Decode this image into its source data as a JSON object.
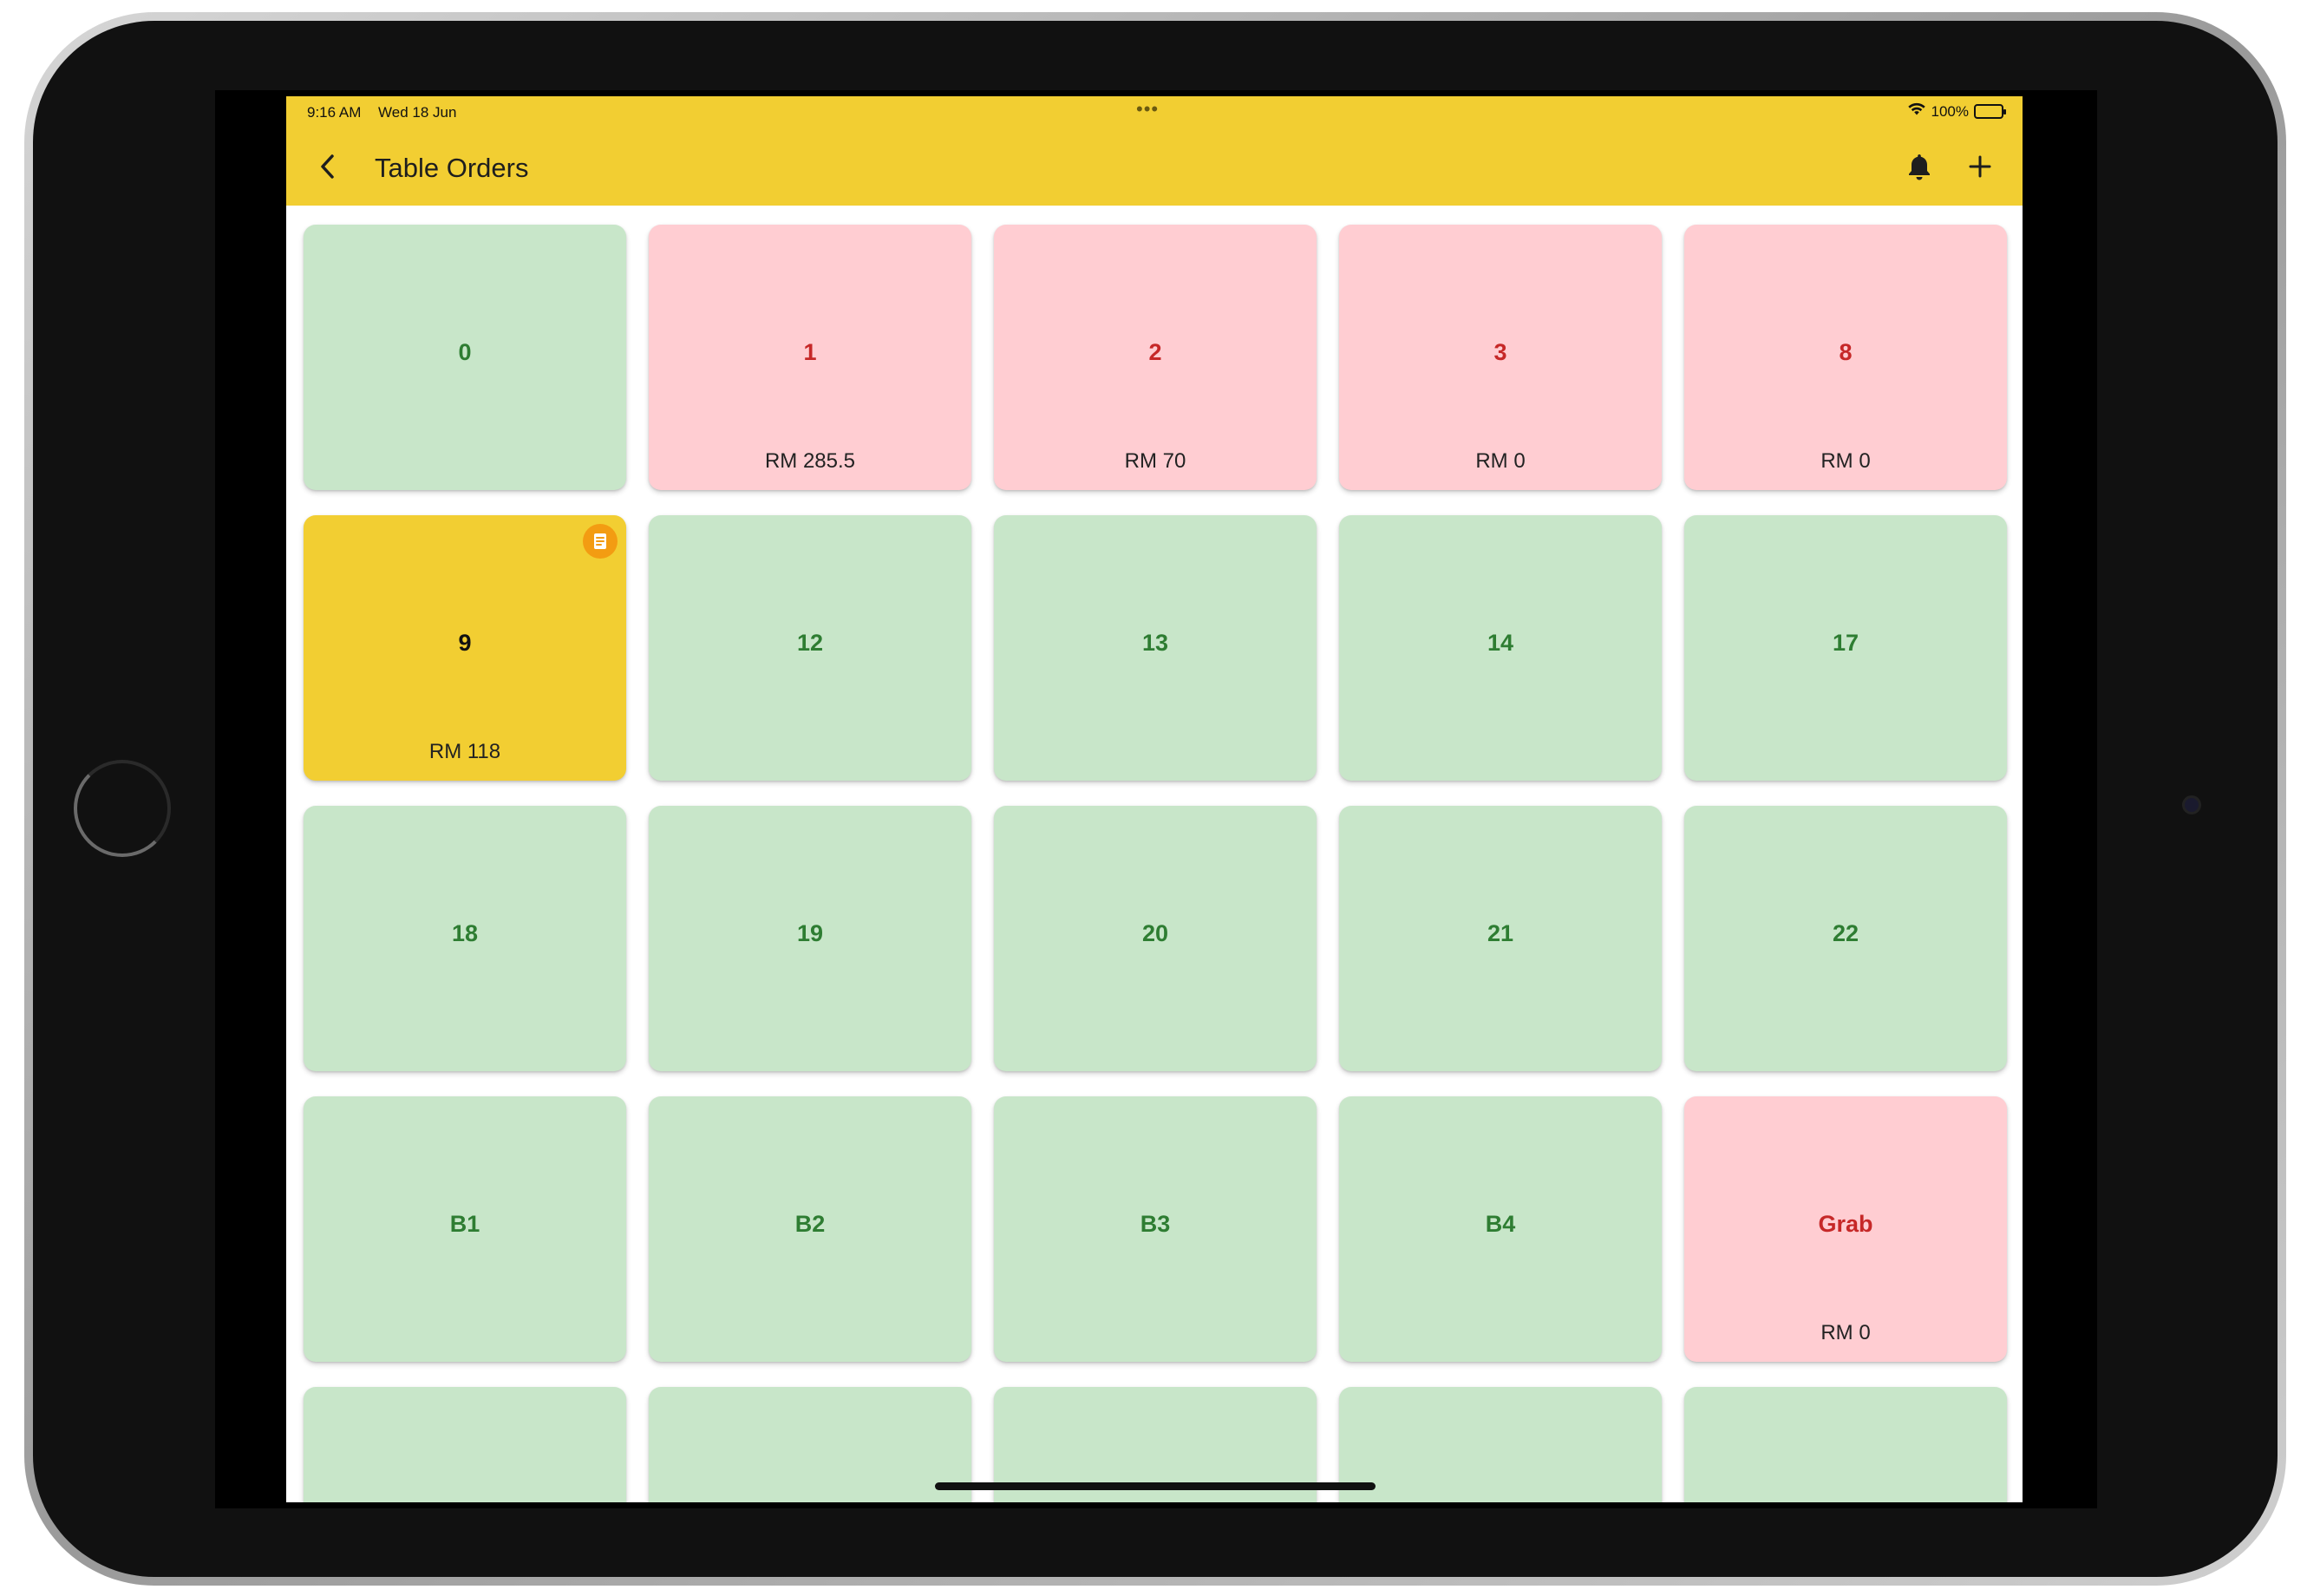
{
  "status_bar": {
    "time": "9:16 AM",
    "date": "Wed 18 Jun",
    "dots": "•••",
    "battery": "100%"
  },
  "app_bar": {
    "title": "Table Orders",
    "back_icon": "chevron-left-icon",
    "notification_icon": "bell-icon",
    "add_icon": "plus-icon"
  },
  "colors": {
    "accent": "#f2ce32",
    "free_bg": "#c8e6c9",
    "free_text": "#2e7d32",
    "busy_bg": "#ffcdd2",
    "busy_text": "#c62828",
    "badge": "#f39c12"
  },
  "tables": [
    {
      "name": "0",
      "status": "free",
      "amount": ""
    },
    {
      "name": "1",
      "status": "busy",
      "amount": "RM 285.5"
    },
    {
      "name": "2",
      "status": "busy",
      "amount": "RM 70"
    },
    {
      "name": "3",
      "status": "busy",
      "amount": "RM 0"
    },
    {
      "name": "8",
      "status": "busy",
      "amount": "RM 0"
    },
    {
      "name": "9",
      "status": "pending",
      "amount": "RM 118",
      "badge": "receipt-icon"
    },
    {
      "name": "12",
      "status": "free",
      "amount": ""
    },
    {
      "name": "13",
      "status": "free",
      "amount": ""
    },
    {
      "name": "14",
      "status": "free",
      "amount": ""
    },
    {
      "name": "17",
      "status": "free",
      "amount": ""
    },
    {
      "name": "18",
      "status": "free",
      "amount": ""
    },
    {
      "name": "19",
      "status": "free",
      "amount": ""
    },
    {
      "name": "20",
      "status": "free",
      "amount": ""
    },
    {
      "name": "21",
      "status": "free",
      "amount": ""
    },
    {
      "name": "22",
      "status": "free",
      "amount": ""
    },
    {
      "name": "B1",
      "status": "free",
      "amount": ""
    },
    {
      "name": "B2",
      "status": "free",
      "amount": ""
    },
    {
      "name": "B3",
      "status": "free",
      "amount": ""
    },
    {
      "name": "B4",
      "status": "free",
      "amount": ""
    },
    {
      "name": "Grab",
      "status": "busy",
      "amount": "RM 0"
    },
    {
      "name": "",
      "status": "free",
      "amount": ""
    },
    {
      "name": "",
      "status": "free",
      "amount": ""
    },
    {
      "name": "",
      "status": "free",
      "amount": ""
    },
    {
      "name": "",
      "status": "free",
      "amount": ""
    },
    {
      "name": "",
      "status": "free",
      "amount": ""
    }
  ]
}
